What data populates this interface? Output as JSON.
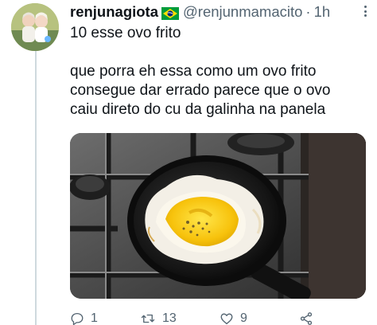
{
  "tweet": {
    "author": {
      "display_name": "renjunagiota",
      "flag_icon": "brazil-flag-icon",
      "handle": "@renjunmamacito",
      "separator": "·",
      "time": "1h"
    },
    "text_lines": [
      "10 esse ovo frito",
      "que porra eh essa  como um ovo frito",
      "consegue dar errado parece que o ovo",
      "caiu direto do cu da galinha na panela"
    ],
    "actions": {
      "reply_count": "1",
      "retweet_count": "13",
      "like_count": "9"
    },
    "icons": {
      "reply": "reply-icon",
      "retweet": "retweet-icon",
      "like": "heart-icon",
      "share": "share-icon",
      "more": "more-icon"
    },
    "colors": {
      "text": "#0f1419",
      "secondary": "#536471",
      "thread_line": "#cfd9de",
      "flag_green": "#009c3b",
      "flag_yellow": "#ffdf00",
      "flag_blue": "#002776"
    }
  }
}
